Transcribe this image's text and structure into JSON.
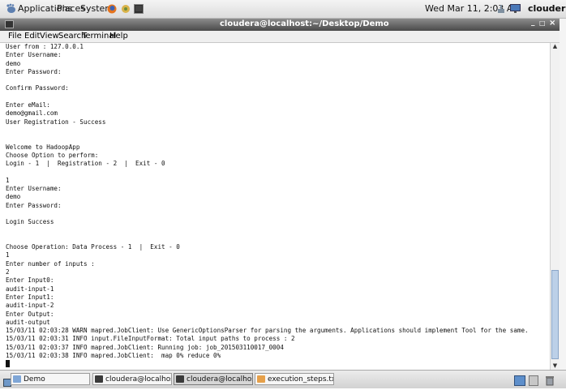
{
  "topbar": {
    "menus": [
      "Applications",
      "Places",
      "System"
    ],
    "clock": "Wed Mar 11,  2:03 AM",
    "user": "cloudera"
  },
  "window": {
    "title": "cloudera@localhost:~/Desktop/Demo",
    "controls": [
      "_",
      "□",
      "×"
    ]
  },
  "menubar": {
    "items": [
      "File",
      "Edit",
      "View",
      "Search",
      "Terminal",
      "Help"
    ]
  },
  "terminal": {
    "lines": [
      "User from : 127.0.0.1",
      "Enter Username:",
      "demo",
      "Enter Password:",
      "",
      "Confirm Password:",
      "",
      "Enter eMail:",
      "demo@gmail.com",
      "User Registration - Success",
      "",
      "",
      "Welcome to HadoopApp",
      "Choose Option to perform:",
      "Login - 1  |  Registration - 2  |  Exit - 0",
      "",
      "1",
      "Enter Username:",
      "demo",
      "Enter Password:",
      "",
      "Login Success",
      "",
      "",
      "Choose Operation: Data Process - 1  |  Exit - 0",
      "1",
      "Enter number of inputs :",
      "2",
      "Enter Input0:",
      "audit-input-1",
      "Enter Input1:",
      "audit-input-2",
      "Enter Output:",
      "audit-output",
      "15/03/11 02:03:28 WARN mapred.JobClient: Use GenericOptionsParser for parsing the arguments. Applications should implement Tool for the same.",
      "15/03/11 02:03:31 INFO input.FileInputFormat: Total input paths to process : 2",
      "15/03/11 02:03:37 INFO mapred.JobClient: Running job: job_201503110017_0004",
      "15/03/11 02:03:38 INFO mapred.JobClient:  map 0% reduce 0%"
    ]
  },
  "taskbar": {
    "items": [
      {
        "label": "Demo",
        "icon": "folder-icon",
        "active": false
      },
      {
        "label": "cloudera@localhost:~/...",
        "icon": "terminal-icon",
        "active": false
      },
      {
        "label": "cloudera@localhost:~/...",
        "icon": "terminal-icon",
        "active": true
      },
      {
        "label": "execution_steps.txt (~...",
        "icon": "text-editor-icon",
        "active": false
      }
    ]
  },
  "colors": {
    "titlebar": "#5a5a5a",
    "scroll_thumb": "#bcd0e8"
  }
}
